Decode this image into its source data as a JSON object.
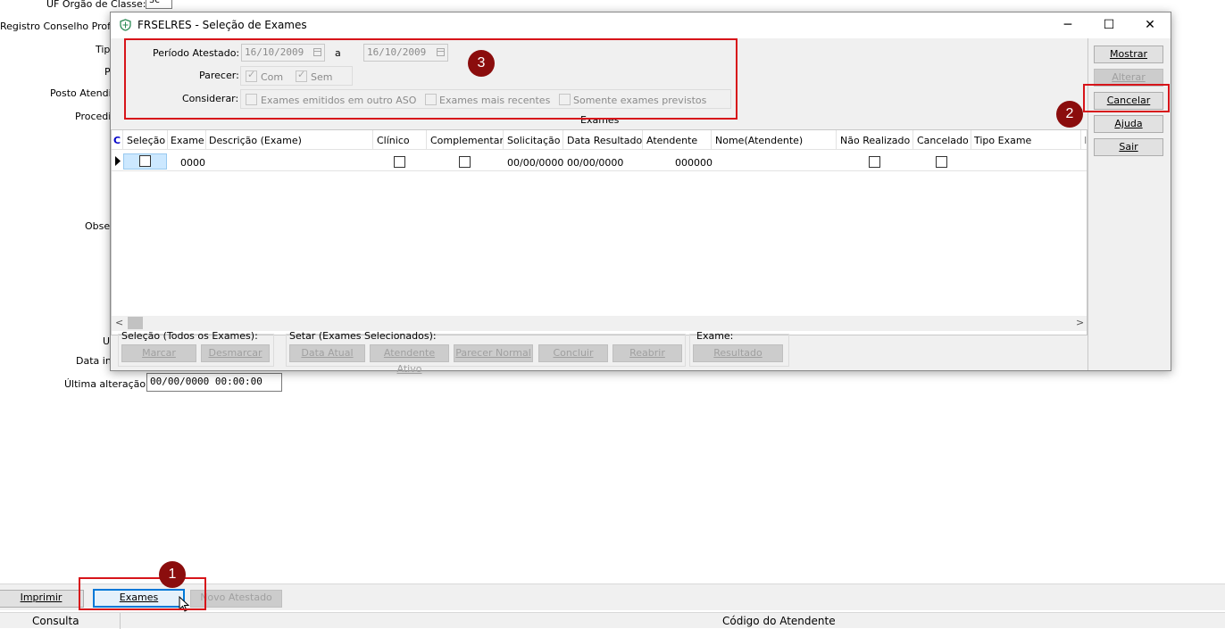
{
  "background_form": {
    "labels": {
      "uf_orgao": "UF Orgão de Classe:",
      "registro": "Registro Conselho Profis",
      "tipo": "Tip",
      "p": "P",
      "posto": "Posto Atendi",
      "procedimento": "Procedi",
      "observacao": "Obse",
      "u": "U",
      "data_in": "Data in",
      "ultima_alteracao": "Última alteração:"
    },
    "uf_value": "SC",
    "ultima_alteracao_value": "00/00/0000 00:00:00",
    "buttons": {
      "imprimir": "Imprimir",
      "exames": "Exames",
      "novo_atestado": "Novo Atestado"
    },
    "status": {
      "left": "Consulta",
      "right": "Código do Atendente"
    }
  },
  "dialog": {
    "title": "FRSELRES - Seleção de Exames",
    "controls": {
      "minimize": "─",
      "maximize": "☐",
      "close": "✕"
    },
    "periodo_label": "Período Atestado:",
    "date_from": "16/10/2009",
    "date_sep": "a",
    "date_to": "16/10/2009",
    "parecer_label": "Parecer:",
    "parecer_com": "Com",
    "parecer_sem": "Sem",
    "considerar_label": "Considerar:",
    "considerar_options": [
      "Exames emitidos em outro ASO",
      "Exames mais recentes",
      "Somente exames previstos"
    ],
    "grid_title": "Exames",
    "columns": [
      "C",
      "Seleção",
      "Exame",
      "Descrição (Exame)",
      "Clínico",
      "Complementar",
      "Solicitação",
      "Data Resultado",
      "Atendente",
      "Nome(Atendente)",
      "Não Realizado",
      "Cancelado",
      "Tipo Exame",
      "I"
    ],
    "row": {
      "exame": "0000",
      "solicitacao": "00/00/0000",
      "data_resultado": "00/00/0000",
      "atendente": "000000"
    },
    "side_buttons": {
      "mostrar": "Mostrar",
      "alterar": "Alterar",
      "cancelar": "Cancelar",
      "ajuda": "Ajuda",
      "sair": "Sair"
    },
    "selecao_group": {
      "title": "Seleção (Todos os Exames):",
      "marcar": "Marcar",
      "desmarcar": "Desmarcar"
    },
    "setar_group": {
      "title": "Setar (Exames Selecionados):",
      "data_atual": "Data Atual",
      "atendente_ativo": "Atendente Ativo",
      "parecer_normal": "Parecer Normal",
      "concluir": "Concluir",
      "reabrir": "Reabrir"
    },
    "exame_group": {
      "title": "Exame:",
      "resultado": "Resultado"
    }
  },
  "annotations": {
    "badge_1": "1",
    "badge_2": "2",
    "badge_3": "3",
    "color": "#d7141a",
    "badge_color": "#8b0d0d"
  }
}
